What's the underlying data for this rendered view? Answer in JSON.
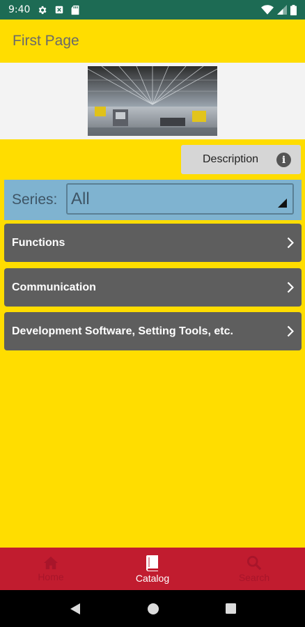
{
  "status_bar": {
    "time": "9:40"
  },
  "app_bar": {
    "title": "First Page"
  },
  "description_button": {
    "label": "Description"
  },
  "series": {
    "label": "Series:",
    "selected": "All"
  },
  "menu": [
    {
      "label": "Functions"
    },
    {
      "label": "Communication"
    },
    {
      "label": "Development Software, Setting Tools, etc."
    }
  ],
  "bottom_nav": [
    {
      "label": "Home",
      "icon": "home-icon",
      "active": false
    },
    {
      "label": "Catalog",
      "icon": "book-icon",
      "active": true
    },
    {
      "label": "Search",
      "icon": "search-icon",
      "active": false
    }
  ],
  "colors": {
    "accent": "#ffdd00",
    "status_bar": "#1d6b54",
    "bottom_nav": "#c11c2f",
    "menu_item": "#5e5e5e",
    "series_bar": "#7fb3d0"
  }
}
